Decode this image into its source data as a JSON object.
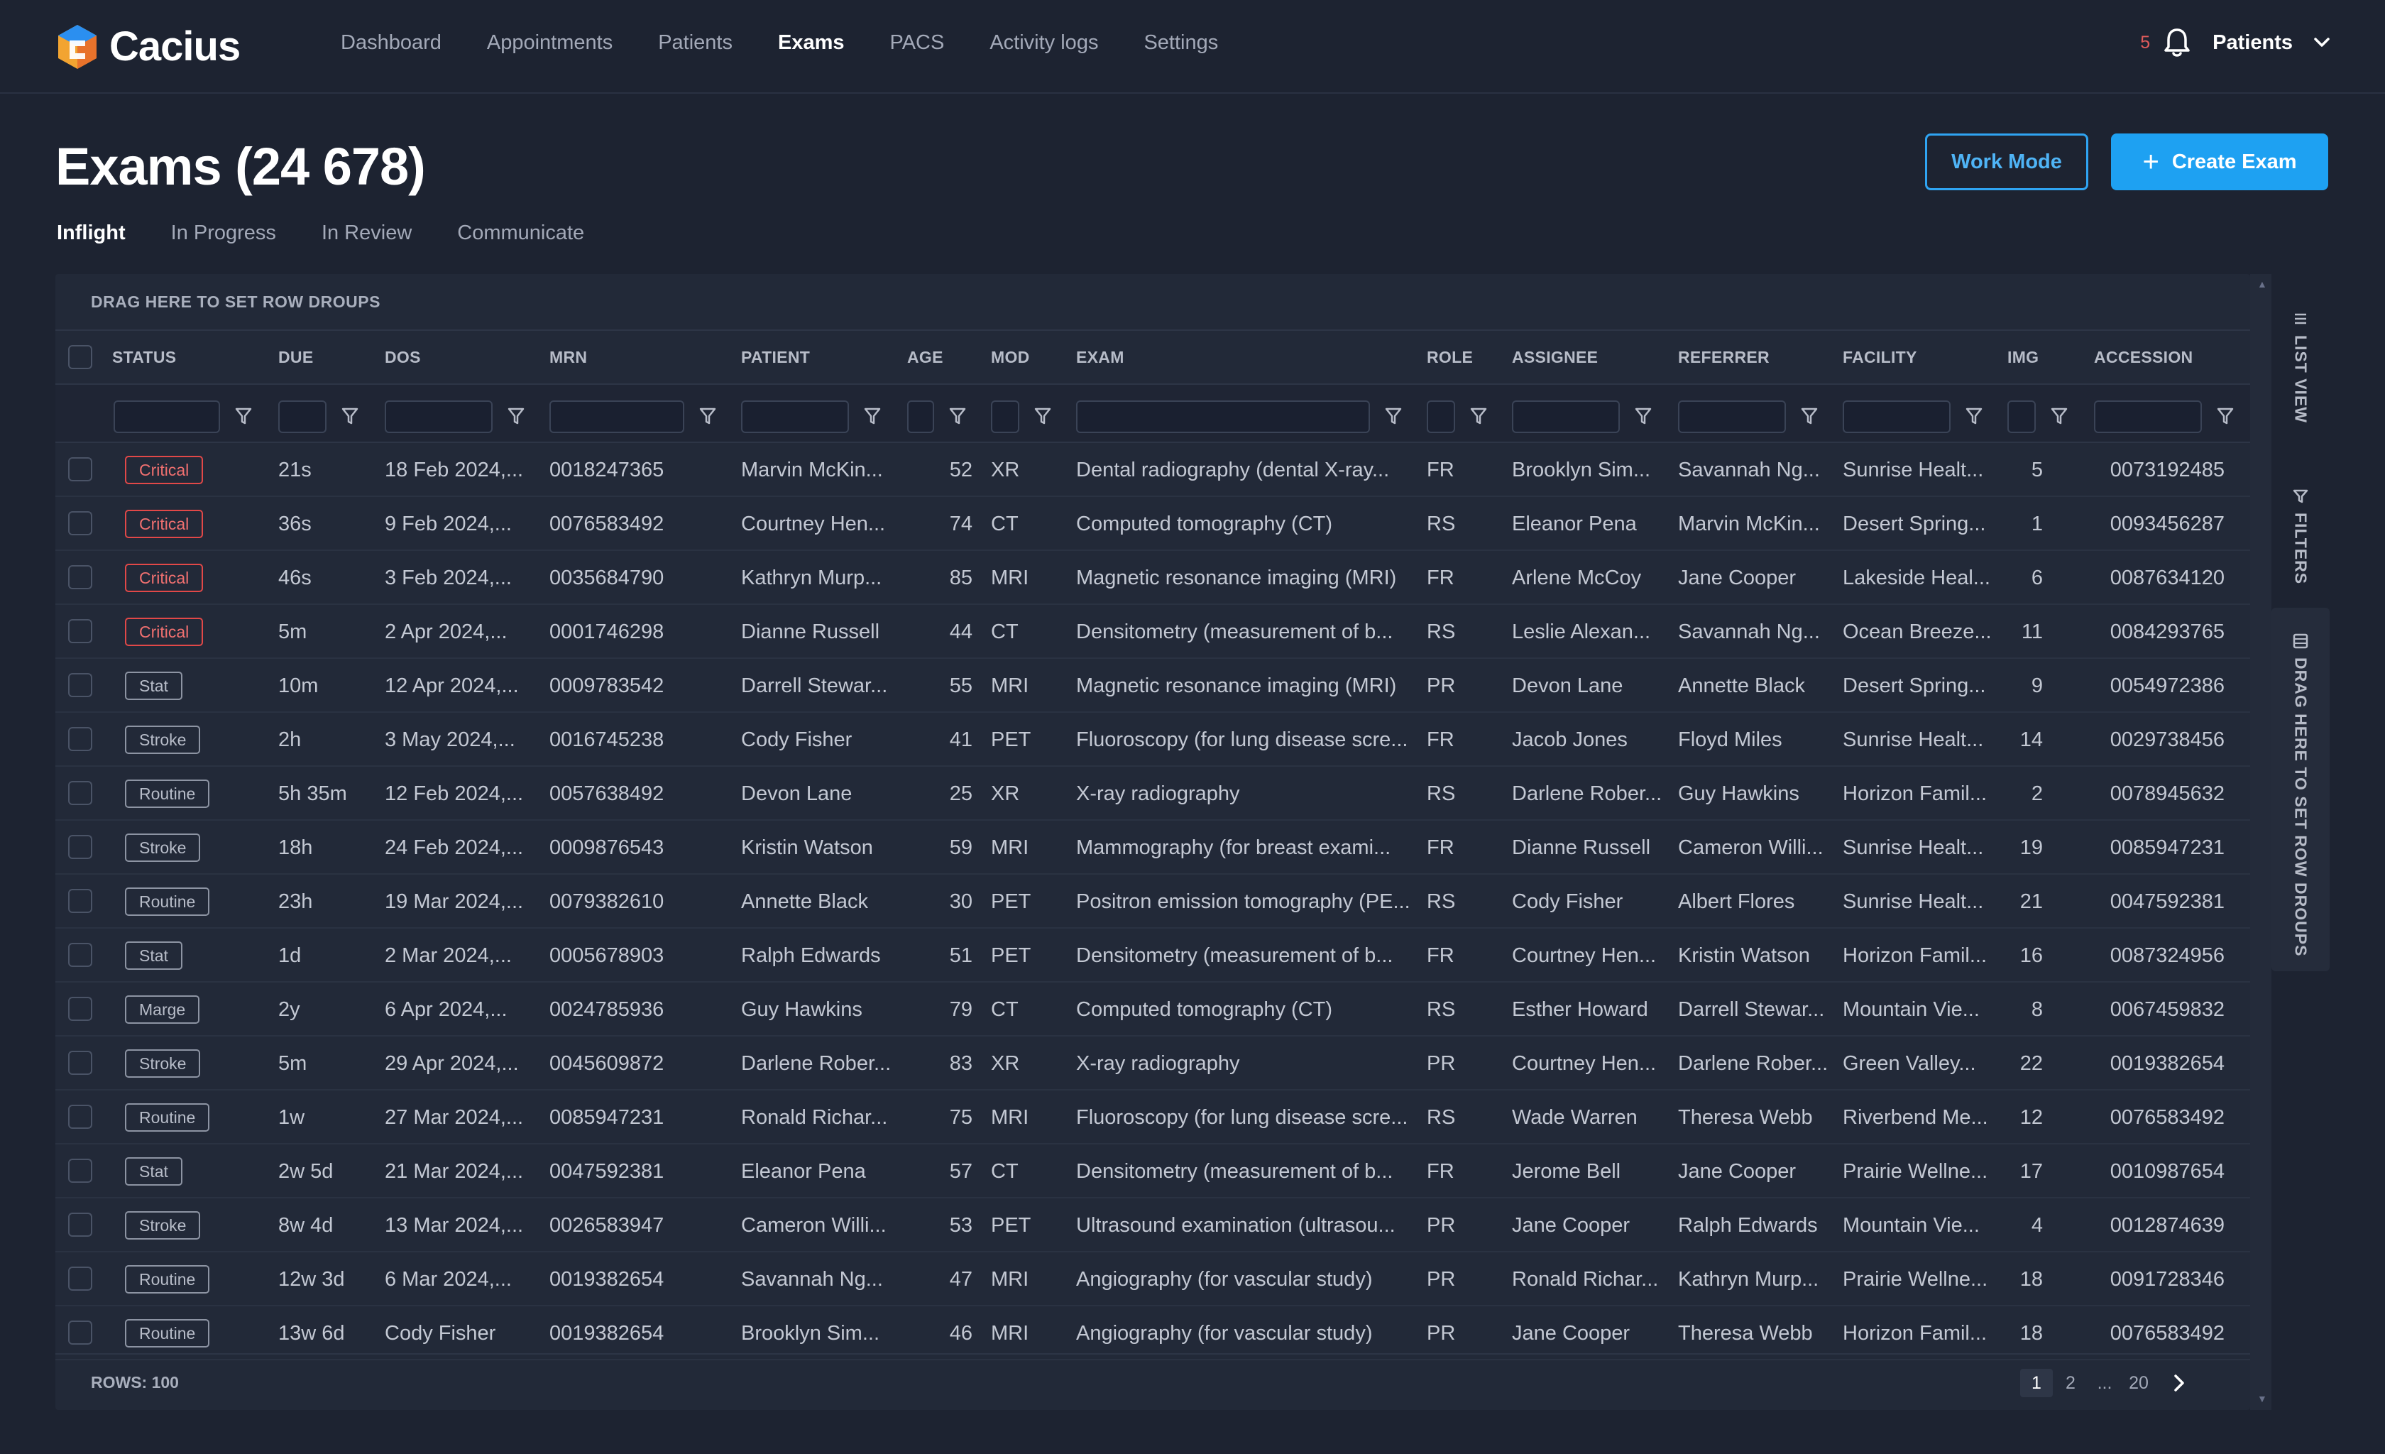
{
  "brand": {
    "name": "Cacius"
  },
  "nav": [
    "Dashboard",
    "Appointments",
    "Patients",
    "Exams",
    "PACS",
    "Activity logs",
    "Settings"
  ],
  "nav_active": "Exams",
  "notifications": {
    "count": "5"
  },
  "user_menu": {
    "label": "Patients"
  },
  "page": {
    "title": "Exams (24 678)"
  },
  "actions": {
    "work_mode": "Work Mode",
    "create_exam": "Create Exam"
  },
  "tabs": [
    "Inflight",
    "In Progress",
    "In Review",
    "Communicate"
  ],
  "tab_active": "Inflight",
  "grid": {
    "group_hint": "DRAG HERE TO SET ROW DROUPS",
    "columns": [
      "STATUS",
      "DUE",
      "DOS",
      "MRN",
      "PATIENT",
      "AGE",
      "MOD",
      "EXAM",
      "ROLE",
      "ASSIGNEE",
      "REFERRER",
      "FACILITY",
      "IMG",
      "ACCESSION"
    ],
    "rows": [
      {
        "status": "Critical",
        "due": "21s",
        "dos": "18 Feb 2024,...",
        "mrn": "0018247365",
        "patient": "Marvin McKin...",
        "age": "52",
        "mod": "XR",
        "exam": "Dental radiography (dental X-ray...",
        "role": "FR",
        "assignee": "Brooklyn Sim...",
        "referrer": "Savannah Ng...",
        "facility": "Sunrise Healt...",
        "img": "5",
        "accession": "0073192485"
      },
      {
        "status": "Critical",
        "due": "36s",
        "dos": "9 Feb 2024,...",
        "mrn": "0076583492",
        "patient": "Courtney Hen...",
        "age": "74",
        "mod": "CT",
        "exam": "Computed tomography (CT)",
        "role": "RS",
        "assignee": "Eleanor Pena",
        "referrer": "Marvin McKin...",
        "facility": "Desert Spring...",
        "img": "1",
        "accession": "0093456287"
      },
      {
        "status": "Critical",
        "due": "46s",
        "dos": "3 Feb 2024,...",
        "mrn": "0035684790",
        "patient": "Kathryn Murp...",
        "age": "85",
        "mod": "MRI",
        "exam": "Magnetic resonance imaging (MRI)",
        "role": "FR",
        "assignee": "Arlene McCoy",
        "referrer": "Jane Cooper",
        "facility": "Lakeside Heal...",
        "img": "6",
        "accession": "0087634120"
      },
      {
        "status": "Critical",
        "due": "5m",
        "dos": "2 Apr 2024,...",
        "mrn": "0001746298",
        "patient": "Dianne Russell",
        "age": "44",
        "mod": "CT",
        "exam": "Densitometry (measurement of b...",
        "role": "RS",
        "assignee": "Leslie Alexan...",
        "referrer": "Savannah Ng...",
        "facility": "Ocean Breeze...",
        "img": "11",
        "accession": "0084293765"
      },
      {
        "status": "Stat",
        "due": "10m",
        "dos": "12 Apr 2024,...",
        "mrn": "0009783542",
        "patient": "Darrell Stewar...",
        "age": "55",
        "mod": "MRI",
        "exam": "Magnetic resonance imaging (MRI)",
        "role": "PR",
        "assignee": "Devon Lane",
        "referrer": "Annette Black",
        "facility": "Desert Spring...",
        "img": "9",
        "accession": "0054972386"
      },
      {
        "status": "Stroke",
        "due": "2h",
        "dos": "3 May 2024,...",
        "mrn": "0016745238",
        "patient": "Cody Fisher",
        "age": "41",
        "mod": "PET",
        "exam": "Fluoroscopy (for lung disease scre...",
        "role": "FR",
        "assignee": "Jacob Jones",
        "referrer": "Floyd Miles",
        "facility": "Sunrise Healt...",
        "img": "14",
        "accession": "0029738456"
      },
      {
        "status": "Routine",
        "due": "5h 35m",
        "dos": "12 Feb 2024,...",
        "mrn": "0057638492",
        "patient": "Devon Lane",
        "age": "25",
        "mod": "XR",
        "exam": "X-ray radiography",
        "role": "RS",
        "assignee": "Darlene Rober...",
        "referrer": "Guy Hawkins",
        "facility": "Horizon Famil...",
        "img": "2",
        "accession": "0078945632"
      },
      {
        "status": "Stroke",
        "due": "18h",
        "dos": "24 Feb 2024,...",
        "mrn": "0009876543",
        "patient": "Kristin Watson",
        "age": "59",
        "mod": "MRI",
        "exam": "Mammography (for breast exami...",
        "role": "FR",
        "assignee": "Dianne Russell",
        "referrer": "Cameron Willi...",
        "facility": "Sunrise Healt...",
        "img": "19",
        "accession": "0085947231"
      },
      {
        "status": "Routine",
        "due": "23h",
        "dos": "19 Mar 2024,...",
        "mrn": "0079382610",
        "patient": "Annette Black",
        "age": "30",
        "mod": "PET",
        "exam": "Positron emission tomography (PE...",
        "role": "RS",
        "assignee": "Cody Fisher",
        "referrer": "Albert Flores",
        "facility": "Sunrise Healt...",
        "img": "21",
        "accession": "0047592381"
      },
      {
        "status": "Stat",
        "due": "1d",
        "dos": "2 Mar 2024,...",
        "mrn": "0005678903",
        "patient": "Ralph Edwards",
        "age": "51",
        "mod": "PET",
        "exam": "Densitometry (measurement of b...",
        "role": "FR",
        "assignee": "Courtney Hen...",
        "referrer": "Kristin Watson",
        "facility": "Horizon Famil...",
        "img": "16",
        "accession": "0087324956"
      },
      {
        "status": "Marge",
        "due": "2y",
        "dos": "6 Apr 2024,...",
        "mrn": "0024785936",
        "patient": "Guy Hawkins",
        "age": "79",
        "mod": "CT",
        "exam": "Computed tomography (CT)",
        "role": "RS",
        "assignee": "Esther Howard",
        "referrer": "Darrell Stewar...",
        "facility": "Mountain Vie...",
        "img": "8",
        "accession": "0067459832"
      },
      {
        "status": "Stroke",
        "due": "5m",
        "dos": "29 Apr 2024,...",
        "mrn": "0045609872",
        "patient": "Darlene Rober...",
        "age": "83",
        "mod": "XR",
        "exam": "X-ray radiography",
        "role": "PR",
        "assignee": "Courtney Hen...",
        "referrer": "Darlene Rober...",
        "facility": "Green Valley...",
        "img": "22",
        "accession": "0019382654"
      },
      {
        "status": "Routine",
        "due": "1w",
        "dos": "27 Mar 2024,...",
        "mrn": "0085947231",
        "patient": "Ronald Richar...",
        "age": "75",
        "mod": "MRI",
        "exam": "Fluoroscopy (for lung disease scre...",
        "role": "RS",
        "assignee": "Wade Warren",
        "referrer": "Theresa Webb",
        "facility": "Riverbend Me...",
        "img": "12",
        "accession": "0076583492"
      },
      {
        "status": "Stat",
        "due": "2w 5d",
        "dos": "21 Mar 2024,...",
        "mrn": "0047592381",
        "patient": "Eleanor Pena",
        "age": "57",
        "mod": "CT",
        "exam": "Densitometry (measurement of b...",
        "role": "FR",
        "assignee": "Jerome Bell",
        "referrer": "Jane Cooper",
        "facility": "Prairie Wellne...",
        "img": "17",
        "accession": "0010987654"
      },
      {
        "status": "Stroke",
        "due": "8w 4d",
        "dos": "13 Mar 2024,...",
        "mrn": "0026583947",
        "patient": "Cameron Willi...",
        "age": "53",
        "mod": "PET",
        "exam": "Ultrasound examination (ultrasou...",
        "role": "PR",
        "assignee": "Jane Cooper",
        "referrer": "Ralph Edwards",
        "facility": "Mountain Vie...",
        "img": "4",
        "accession": "0012874639"
      },
      {
        "status": "Routine",
        "due": "12w 3d",
        "dos": "6 Mar 2024,...",
        "mrn": "0019382654",
        "patient": "Savannah Ng...",
        "age": "47",
        "mod": "MRI",
        "exam": "Angiography (for vascular study)",
        "role": "PR",
        "assignee": "Ronald Richar...",
        "referrer": "Kathryn Murp...",
        "facility": "Prairie Wellne...",
        "img": "18",
        "accession": "0091728346"
      },
      {
        "status": "Routine",
        "due": "13w 6d",
        "dos": "Cody Fisher",
        "mrn": "0019382654",
        "patient": "Brooklyn Sim...",
        "age": "46",
        "mod": "MRI",
        "exam": "Angiography (for vascular study)",
        "role": "PR",
        "assignee": "Jane Cooper",
        "referrer": "Theresa Webb",
        "facility": "Horizon Famil...",
        "img": "18",
        "accession": "0076583492"
      }
    ],
    "rows_label": "ROWS: 100",
    "pagination": [
      "1",
      "2",
      "...",
      "20"
    ],
    "page_active": "1"
  },
  "side_panel": {
    "list_view": "LIST VIEW",
    "filters": "FILTERS",
    "group_hint": "DRAG HERE TO SET ROW DROUPS"
  },
  "colors": {
    "background": "#1d2331",
    "accent": "#1ea1f2",
    "critical": "#e14848"
  }
}
